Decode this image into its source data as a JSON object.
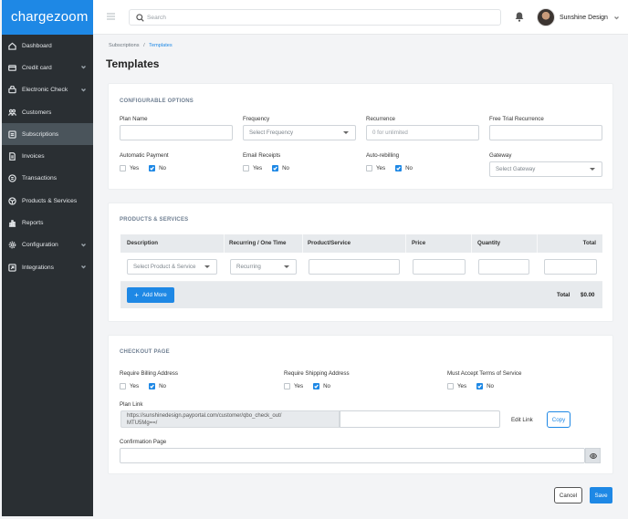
{
  "app": {
    "logo": "chargezoom"
  },
  "sidebar": {
    "items": [
      {
        "label": "Dashboard",
        "icon": "home-icon",
        "expandable": false,
        "active": false
      },
      {
        "label": "Credit card",
        "icon": "credit-card-icon",
        "expandable": true,
        "active": false
      },
      {
        "label": "Electronic Check",
        "icon": "bank-icon",
        "expandable": true,
        "active": false
      },
      {
        "label": "Customers",
        "icon": "users-icon",
        "expandable": false,
        "active": false
      },
      {
        "label": "Subscriptions",
        "icon": "subscription-icon",
        "expandable": false,
        "active": true
      },
      {
        "label": "Invoices",
        "icon": "invoice-icon",
        "expandable": false,
        "active": false
      },
      {
        "label": "Transactions",
        "icon": "transactions-icon",
        "expandable": false,
        "active": false
      },
      {
        "label": "Products & Services",
        "icon": "box-icon",
        "expandable": false,
        "active": false
      },
      {
        "label": "Reports",
        "icon": "bar-chart-icon",
        "expandable": false,
        "active": false
      },
      {
        "label": "Configuration",
        "icon": "gear-icon",
        "expandable": true,
        "active": false
      },
      {
        "label": "Integrations",
        "icon": "integrations-icon",
        "expandable": true,
        "active": false
      }
    ]
  },
  "topbar": {
    "search_placeholder": "Search",
    "user_name": "Sunshine Design"
  },
  "breadcrumb": {
    "parent": "Subscriptions",
    "separator": "/",
    "current": "Templates"
  },
  "page": {
    "title": "Templates"
  },
  "configurable": {
    "title": "CONFIGURABLE OPTIONS",
    "plan_name_label": "Plan Name",
    "plan_name_value": "",
    "frequency_label": "Frequency",
    "frequency_value": "Select Frequency",
    "recurrence_label": "Recurrence",
    "recurrence_placeholder": "0 for unlimited",
    "free_trial_label": "Free Trial Recurrence",
    "free_trial_value": "",
    "automatic_payment_label": "Automatic Payment",
    "email_receipts_label": "Email Receipts",
    "auto_rebilling_label": "Auto-rebilling",
    "gateway_label": "Gateway",
    "gateway_value": "Select Gateway",
    "yes": "Yes",
    "no": "No"
  },
  "products": {
    "title": "PRODUCTS & SERVICES",
    "columns": [
      "Description",
      "Recurring / One Time",
      "Product/Service",
      "Price",
      "Quantity",
      "Total"
    ],
    "row": {
      "product_select": "Select Product & Service",
      "recurring_select": "Recurring"
    },
    "add_more": "Add More",
    "total_label": "Total",
    "total_value": "$0.00"
  },
  "checkout": {
    "title": "CHECKOUT PAGE",
    "billing_label": "Require Billing Address",
    "shipping_label": "Require Shipping Address",
    "terms_label": "Must Accept Terms of Service",
    "yes": "Yes",
    "no": "No",
    "plan_link_label": "Plan Link",
    "plan_link_line1": "https://sunshinedesign.payportal.com/customer/qbo_check_out/",
    "plan_link_line2": "MTU5Mg==/",
    "edit_link": "Edit Link",
    "copy": "Copy",
    "confirmation_label": "Confirmation Page",
    "confirmation_value": ""
  },
  "footer": {
    "cancel": "Cancel",
    "save": "Save"
  },
  "colors": {
    "accent": "#1e88e5",
    "sidebar": "#2a2f33",
    "sidebar_active": "#4a545b"
  }
}
